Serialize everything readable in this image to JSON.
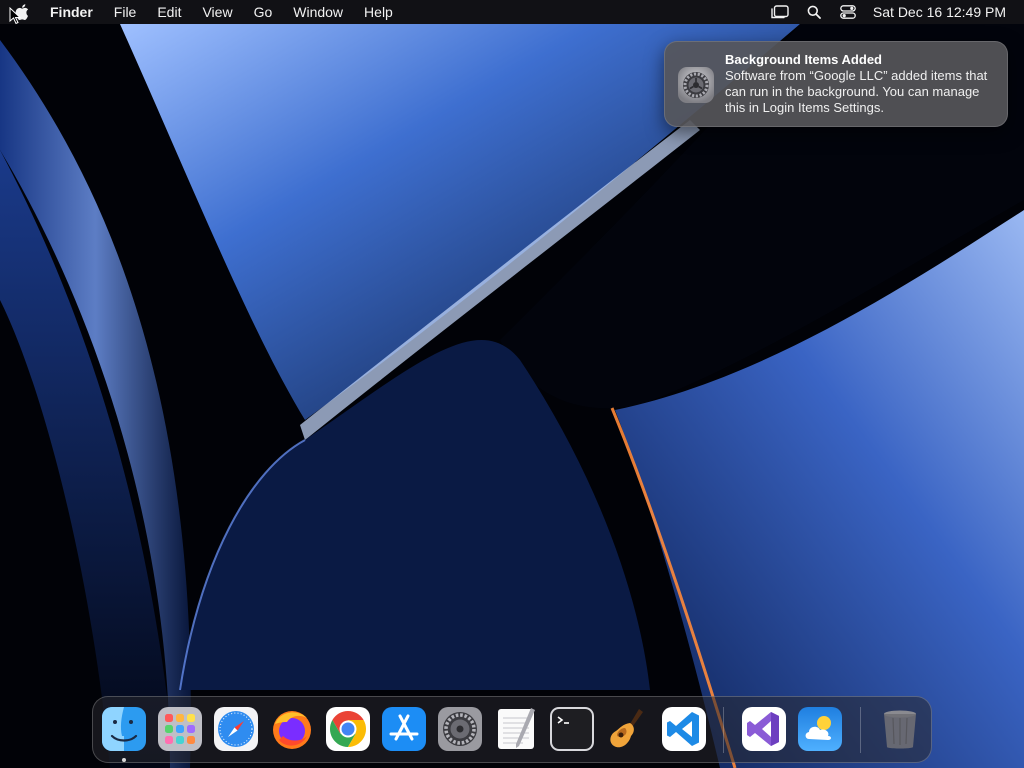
{
  "menubar": {
    "app_name": "Finder",
    "menus": [
      "File",
      "Edit",
      "View",
      "Go",
      "Window",
      "Help"
    ],
    "clock": "Sat Dec 16  12:49 PM",
    "status_icons": [
      "stage-manager-icon",
      "search-icon",
      "control-center-icon"
    ]
  },
  "notification": {
    "title": "Background Items Added",
    "body": "Software from “Google LLC” added items that can run in the background. You can manage this in Login Items Settings.",
    "app_icon": "system-settings-icon"
  },
  "dock": {
    "apps": [
      {
        "name": "Finder",
        "icon": "finder-icon",
        "running": true
      },
      {
        "name": "Launchpad",
        "icon": "launchpad-icon",
        "running": false
      },
      {
        "name": "Safari",
        "icon": "safari-icon",
        "running": false
      },
      {
        "name": "Firefox",
        "icon": "firefox-icon",
        "running": false
      },
      {
        "name": "Google Chrome",
        "icon": "chrome-icon",
        "running": false
      },
      {
        "name": "App Store",
        "icon": "app-store-icon",
        "running": false
      },
      {
        "name": "System Settings",
        "icon": "system-settings-icon",
        "running": false
      },
      {
        "name": "TextEdit",
        "icon": "textedit-icon",
        "running": false
      },
      {
        "name": "Terminal",
        "icon": "terminal-icon",
        "running": false
      },
      {
        "name": "GarageBand",
        "icon": "garageband-icon",
        "running": false
      },
      {
        "name": "Visual Studio Code",
        "icon": "vscode-icon",
        "running": false
      },
      {
        "name": "Visual Studio",
        "icon": "visual-studio-icon",
        "running": false
      },
      {
        "name": "Weather",
        "icon": "weather-icon",
        "running": false
      },
      {
        "name": "Trash",
        "icon": "trash-icon",
        "running": false
      }
    ]
  },
  "colors": {
    "menubar_bg": "#18181c",
    "notification_bg": "#56565a",
    "wallpaper_accent": "#3b6fd6",
    "wallpaper_glow": "#ff7a2a"
  }
}
